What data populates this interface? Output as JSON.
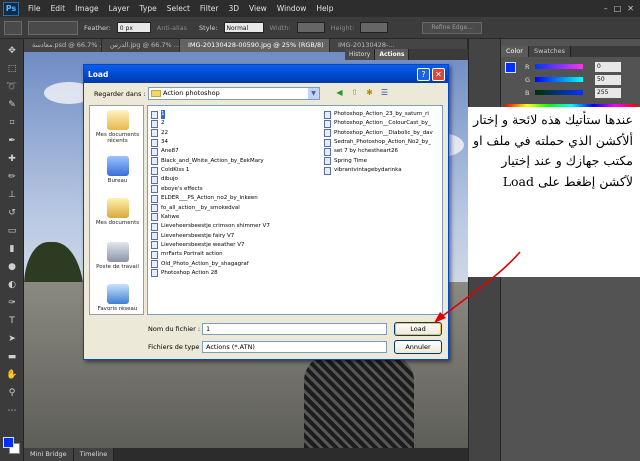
{
  "menubar": {
    "app_logo": "Ps",
    "items": [
      "File",
      "Edit",
      "Image",
      "Layer",
      "Type",
      "Select",
      "Filter",
      "3D",
      "View",
      "Window",
      "Help"
    ],
    "window_controls": [
      "–",
      "□",
      "✕"
    ]
  },
  "options_bar": {
    "feather_label": "Feather:",
    "feather_value": "0 px",
    "antialias_label": "Anti-alias",
    "style_label": "Style:",
    "style_value": "Normal",
    "width_label": "Width:",
    "height_label": "Height:",
    "refine_edge_label": "Refine Edge..."
  },
  "document_tabs": [
    {
      "label": "معادسة.psd @ 66.7% ...",
      "active": false
    },
    {
      "label": "الدرس.jpg @ 66.7% ...",
      "active": false
    },
    {
      "label": "IMG-20130428-00590.jpg @ 25% (RGB/8)",
      "active": true
    },
    {
      "label": "IMG-20130428-...",
      "active": false
    }
  ],
  "history_panel": {
    "tabs": [
      {
        "label": "History",
        "active": false
      },
      {
        "label": "Actions",
        "active": true
      }
    ]
  },
  "color_panel": {
    "tabs": [
      {
        "label": "Color",
        "active": true
      },
      {
        "label": "Swatches",
        "active": false
      }
    ],
    "channels": [
      {
        "letter": "R",
        "value": "0"
      },
      {
        "letter": "G",
        "value": "50"
      },
      {
        "letter": "B",
        "value": "255"
      }
    ],
    "foreground": "#0030ff"
  },
  "bottom_tabs": [
    "Mini Bridge",
    "Timeline"
  ],
  "dialog": {
    "title": "Load",
    "help_glyph": "?",
    "close_glyph": "✕",
    "look_in_label": "Regarder dans :",
    "look_in_value": "Action photoshop",
    "places": [
      {
        "label": "Mes documents récents",
        "icon": "recent-documents-icon"
      },
      {
        "label": "Bureau",
        "icon": "desktop-icon"
      },
      {
        "label": "Mes documents",
        "icon": "my-documents-icon"
      },
      {
        "label": "Poste de travail",
        "icon": "my-computer-icon"
      },
      {
        "label": "Favoris réseau",
        "icon": "network-places-icon"
      }
    ],
    "files_col1": [
      "1",
      "2",
      "22",
      "34",
      "Ane87",
      "Black_and_White_Action_by_EekMary",
      "ColdKiss 1",
      "dibujo",
      "eboye's effects",
      "ELDER___PS_Action_no2_by_inkeen",
      "fo_all_action__by_smokedval",
      "Kahwe",
      "Lieveheersbeestje crimson shimmer V7",
      "Lieveheersbeestje fairy V7",
      "Lieveheersbeestje weather V7",
      "mrFarts Portrait action",
      "Old_Photo_Action_by_shagagraf",
      "Photoshop Action 28"
    ],
    "files_col2": [
      "Photoshop_Action_23_by_saturn_ri",
      "Photoshop_Action__ColourCast_by_",
      "Photoshop_Action__Diabolic_by_dav",
      "Sedrah_Photoshop_Action_No2_by_",
      "set 7 by hchestheart26",
      "Spring Time",
      "vibrantvintagebydarinka"
    ],
    "selected_file": "1",
    "filename_label": "Nom du fichier :",
    "filename_value": "1",
    "filetype_label": "Fichiers de type :",
    "filetype_value": "Actions (*.ATN)",
    "load_button": "Load",
    "cancel_button": "Annuler"
  },
  "annotation": {
    "text": "عندها ستأتيك هذه لائحة و إختار ألأكشن الذي حملته في ملف او مكتب جهازك و عند إختيار لآكشن إظغط على Load"
  }
}
